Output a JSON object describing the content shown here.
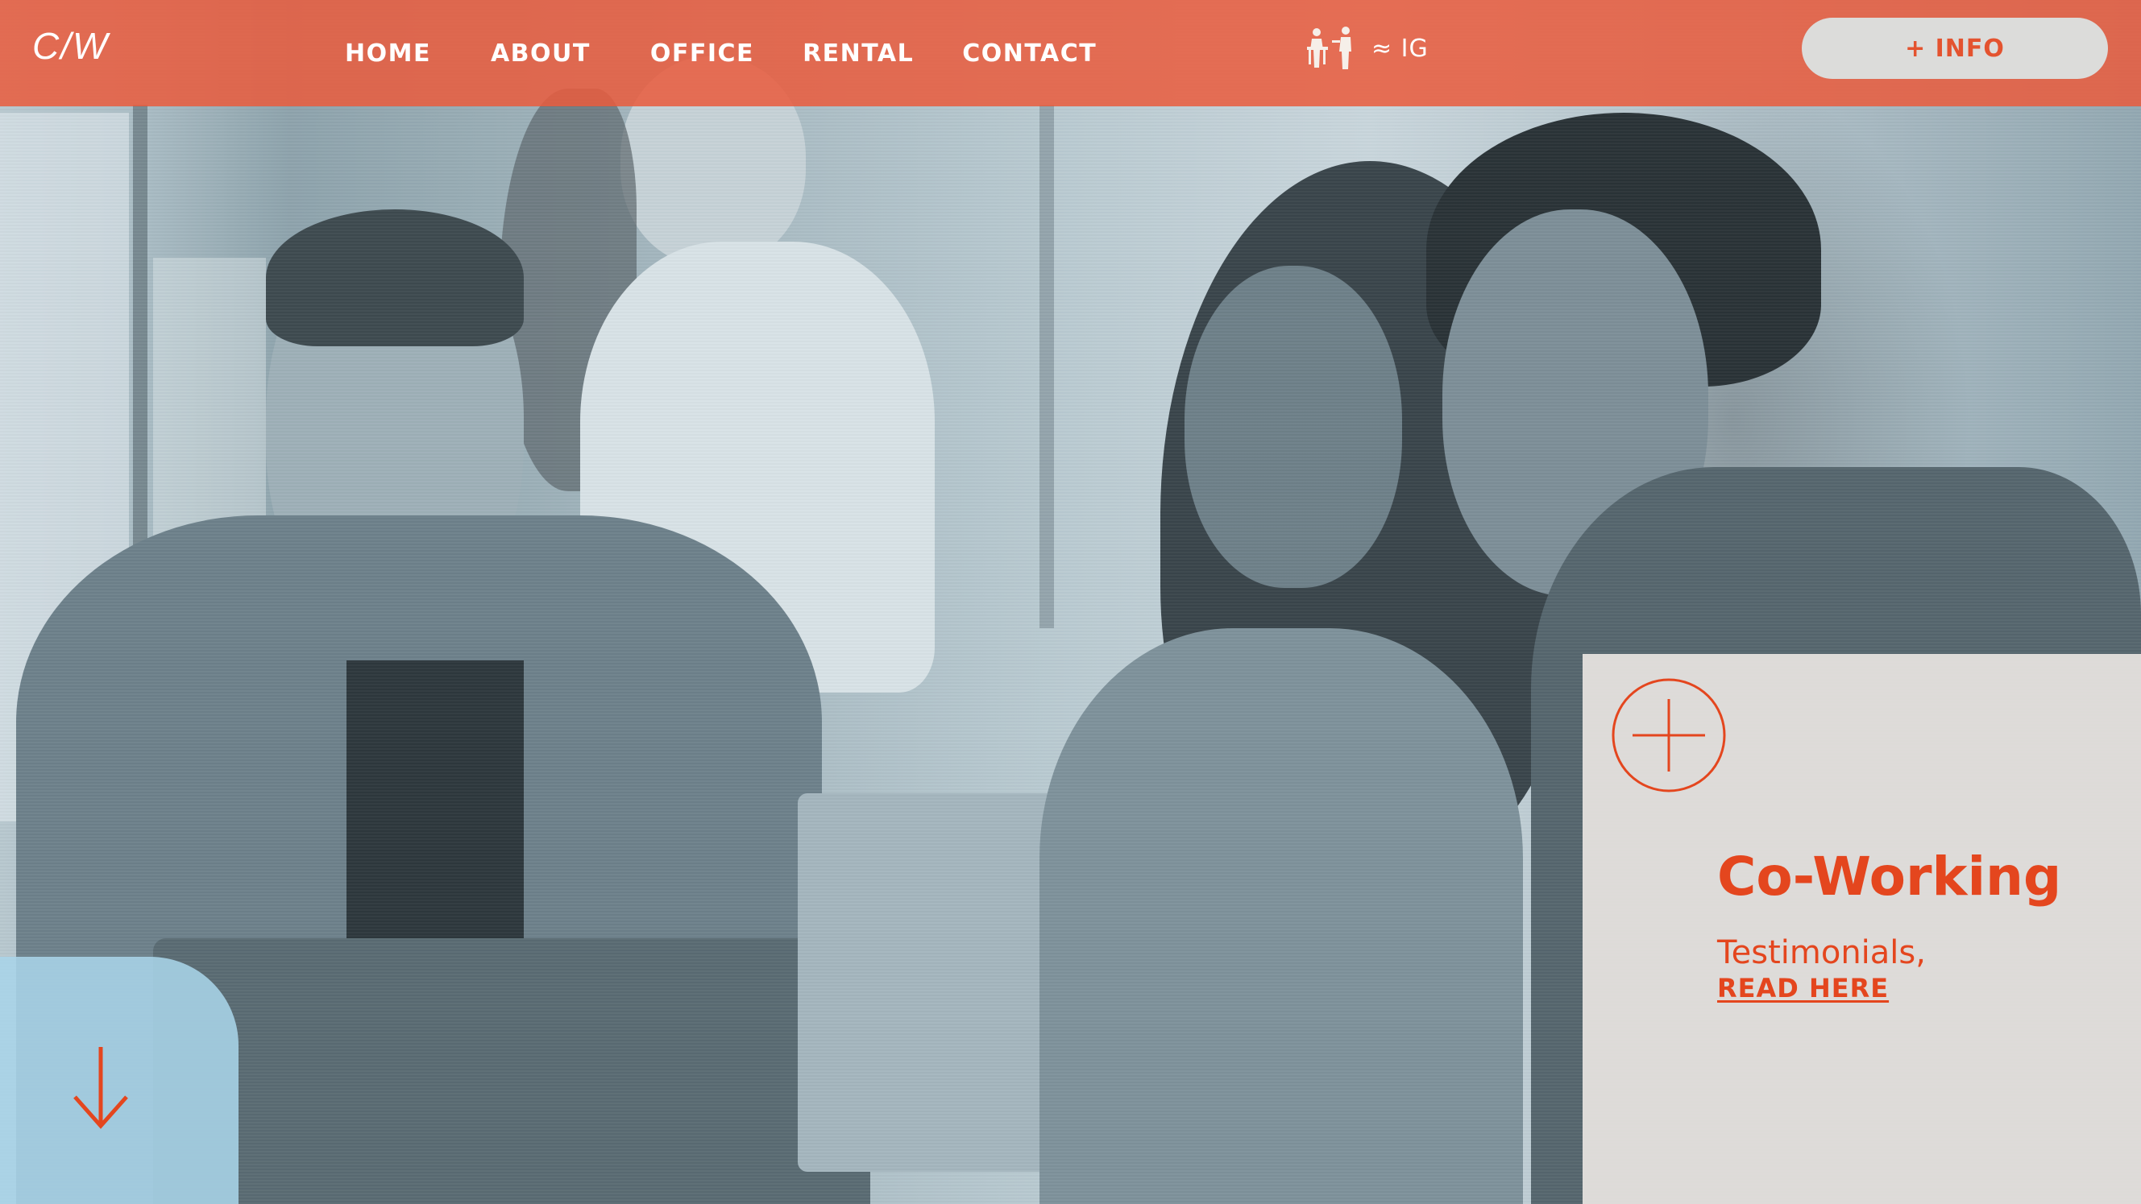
{
  "brand": {
    "logo": "C/W"
  },
  "nav": {
    "items": [
      "HOME",
      "ABOUT",
      "OFFICE",
      "RENTAL",
      "CONTACT"
    ]
  },
  "social": {
    "label": "≈ IG",
    "icon": "people-logo-icon"
  },
  "header": {
    "info_button": "+ INFO"
  },
  "card": {
    "title": "Co-Working",
    "subtitle": "Testimonials,",
    "link": "READ HERE",
    "icon": "plus-circle-icon"
  },
  "scroll": {
    "icon": "arrow-down-icon"
  },
  "colors": {
    "accent": "#e95c3e",
    "accent_text": "#e4461e",
    "button_bg": "#dcdcda",
    "tab_bg": "#a8d4e8",
    "card_bg": "#ece8e4"
  }
}
